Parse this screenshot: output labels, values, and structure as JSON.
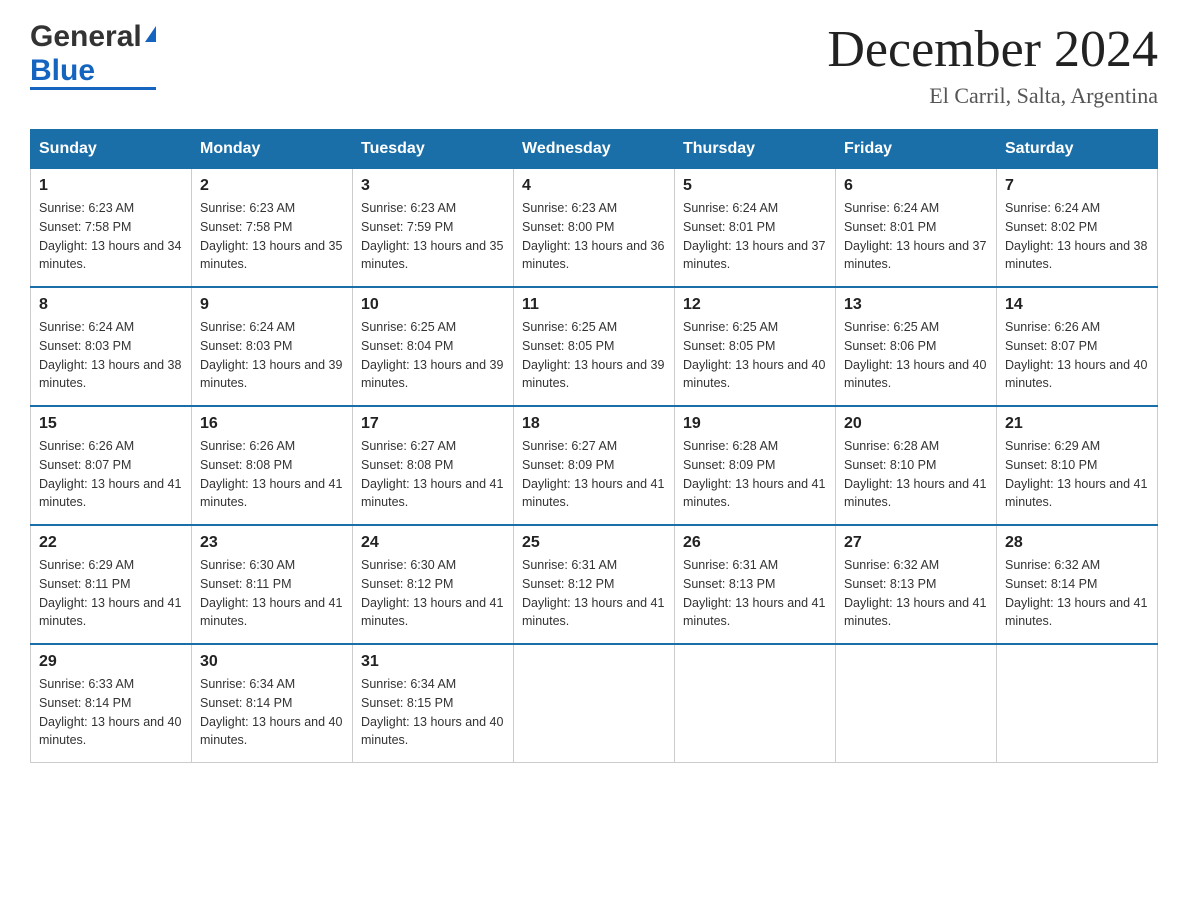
{
  "header": {
    "logo_general": "General",
    "logo_blue": "Blue",
    "month_title": "December 2024",
    "location": "El Carril, Salta, Argentina"
  },
  "days_of_week": [
    "Sunday",
    "Monday",
    "Tuesday",
    "Wednesday",
    "Thursday",
    "Friday",
    "Saturday"
  ],
  "weeks": [
    [
      {
        "day": "1",
        "sunrise": "6:23 AM",
        "sunset": "7:58 PM",
        "daylight": "13 hours and 34 minutes."
      },
      {
        "day": "2",
        "sunrise": "6:23 AM",
        "sunset": "7:58 PM",
        "daylight": "13 hours and 35 minutes."
      },
      {
        "day": "3",
        "sunrise": "6:23 AM",
        "sunset": "7:59 PM",
        "daylight": "13 hours and 35 minutes."
      },
      {
        "day": "4",
        "sunrise": "6:23 AM",
        "sunset": "8:00 PM",
        "daylight": "13 hours and 36 minutes."
      },
      {
        "day": "5",
        "sunrise": "6:24 AM",
        "sunset": "8:01 PM",
        "daylight": "13 hours and 37 minutes."
      },
      {
        "day": "6",
        "sunrise": "6:24 AM",
        "sunset": "8:01 PM",
        "daylight": "13 hours and 37 minutes."
      },
      {
        "day": "7",
        "sunrise": "6:24 AM",
        "sunset": "8:02 PM",
        "daylight": "13 hours and 38 minutes."
      }
    ],
    [
      {
        "day": "8",
        "sunrise": "6:24 AM",
        "sunset": "8:03 PM",
        "daylight": "13 hours and 38 minutes."
      },
      {
        "day": "9",
        "sunrise": "6:24 AM",
        "sunset": "8:03 PM",
        "daylight": "13 hours and 39 minutes."
      },
      {
        "day": "10",
        "sunrise": "6:25 AM",
        "sunset": "8:04 PM",
        "daylight": "13 hours and 39 minutes."
      },
      {
        "day": "11",
        "sunrise": "6:25 AM",
        "sunset": "8:05 PM",
        "daylight": "13 hours and 39 minutes."
      },
      {
        "day": "12",
        "sunrise": "6:25 AM",
        "sunset": "8:05 PM",
        "daylight": "13 hours and 40 minutes."
      },
      {
        "day": "13",
        "sunrise": "6:25 AM",
        "sunset": "8:06 PM",
        "daylight": "13 hours and 40 minutes."
      },
      {
        "day": "14",
        "sunrise": "6:26 AM",
        "sunset": "8:07 PM",
        "daylight": "13 hours and 40 minutes."
      }
    ],
    [
      {
        "day": "15",
        "sunrise": "6:26 AM",
        "sunset": "8:07 PM",
        "daylight": "13 hours and 41 minutes."
      },
      {
        "day": "16",
        "sunrise": "6:26 AM",
        "sunset": "8:08 PM",
        "daylight": "13 hours and 41 minutes."
      },
      {
        "day": "17",
        "sunrise": "6:27 AM",
        "sunset": "8:08 PM",
        "daylight": "13 hours and 41 minutes."
      },
      {
        "day": "18",
        "sunrise": "6:27 AM",
        "sunset": "8:09 PM",
        "daylight": "13 hours and 41 minutes."
      },
      {
        "day": "19",
        "sunrise": "6:28 AM",
        "sunset": "8:09 PM",
        "daylight": "13 hours and 41 minutes."
      },
      {
        "day": "20",
        "sunrise": "6:28 AM",
        "sunset": "8:10 PM",
        "daylight": "13 hours and 41 minutes."
      },
      {
        "day": "21",
        "sunrise": "6:29 AM",
        "sunset": "8:10 PM",
        "daylight": "13 hours and 41 minutes."
      }
    ],
    [
      {
        "day": "22",
        "sunrise": "6:29 AM",
        "sunset": "8:11 PM",
        "daylight": "13 hours and 41 minutes."
      },
      {
        "day": "23",
        "sunrise": "6:30 AM",
        "sunset": "8:11 PM",
        "daylight": "13 hours and 41 minutes."
      },
      {
        "day": "24",
        "sunrise": "6:30 AM",
        "sunset": "8:12 PM",
        "daylight": "13 hours and 41 minutes."
      },
      {
        "day": "25",
        "sunrise": "6:31 AM",
        "sunset": "8:12 PM",
        "daylight": "13 hours and 41 minutes."
      },
      {
        "day": "26",
        "sunrise": "6:31 AM",
        "sunset": "8:13 PM",
        "daylight": "13 hours and 41 minutes."
      },
      {
        "day": "27",
        "sunrise": "6:32 AM",
        "sunset": "8:13 PM",
        "daylight": "13 hours and 41 minutes."
      },
      {
        "day": "28",
        "sunrise": "6:32 AM",
        "sunset": "8:14 PM",
        "daylight": "13 hours and 41 minutes."
      }
    ],
    [
      {
        "day": "29",
        "sunrise": "6:33 AM",
        "sunset": "8:14 PM",
        "daylight": "13 hours and 40 minutes."
      },
      {
        "day": "30",
        "sunrise": "6:34 AM",
        "sunset": "8:14 PM",
        "daylight": "13 hours and 40 minutes."
      },
      {
        "day": "31",
        "sunrise": "6:34 AM",
        "sunset": "8:15 PM",
        "daylight": "13 hours and 40 minutes."
      },
      null,
      null,
      null,
      null
    ]
  ],
  "labels": {
    "sunrise": "Sunrise:",
    "sunset": "Sunset:",
    "daylight": "Daylight:"
  }
}
